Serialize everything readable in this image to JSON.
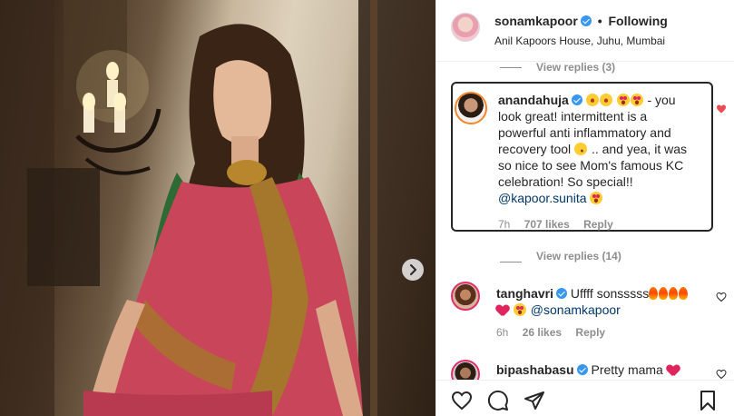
{
  "header": {
    "username": "sonamkapoor",
    "separator": "•",
    "follow_label": "Following",
    "location": "Anil Kapoors House, Juhu, Mumbai"
  },
  "replies_top": {
    "label": "View replies (3)"
  },
  "comment_1": {
    "username": "anandahuja",
    "text_line1": "- you",
    "text_line2": "look great! intermittent is a",
    "text_line3": "powerful anti inflammatory and",
    "text_line4_a": "recovery tool",
    "text_line4_b": ".. and yea, it was",
    "text_line5": "so nice to see Mom's famous KC",
    "text_line6": "celebration! So special!!",
    "mention": "@kapoor.sunita",
    "time": "7h",
    "likes": "707 likes",
    "reply_label": "Reply",
    "liked_color": "#ed4956"
  },
  "replies_mid": {
    "label": "View replies (14)"
  },
  "comment_2": {
    "username": "tanghavri",
    "text": "Uffff sonsssss",
    "mention": "@sonamkapoor",
    "time": "6h",
    "likes": "26 likes",
    "reply_label": "Reply"
  },
  "comment_3": {
    "username": "bipashabasu",
    "text": "Pretty mama"
  },
  "icons": {
    "next": "chevron-right-icon",
    "like": "heart-outline-icon",
    "comment": "speech-bubble-icon",
    "share": "paper-plane-icon",
    "save": "bookmark-icon"
  },
  "colors": {
    "verified": "#3897f0",
    "meta": "#8e8e8e",
    "mention": "#00376b"
  }
}
